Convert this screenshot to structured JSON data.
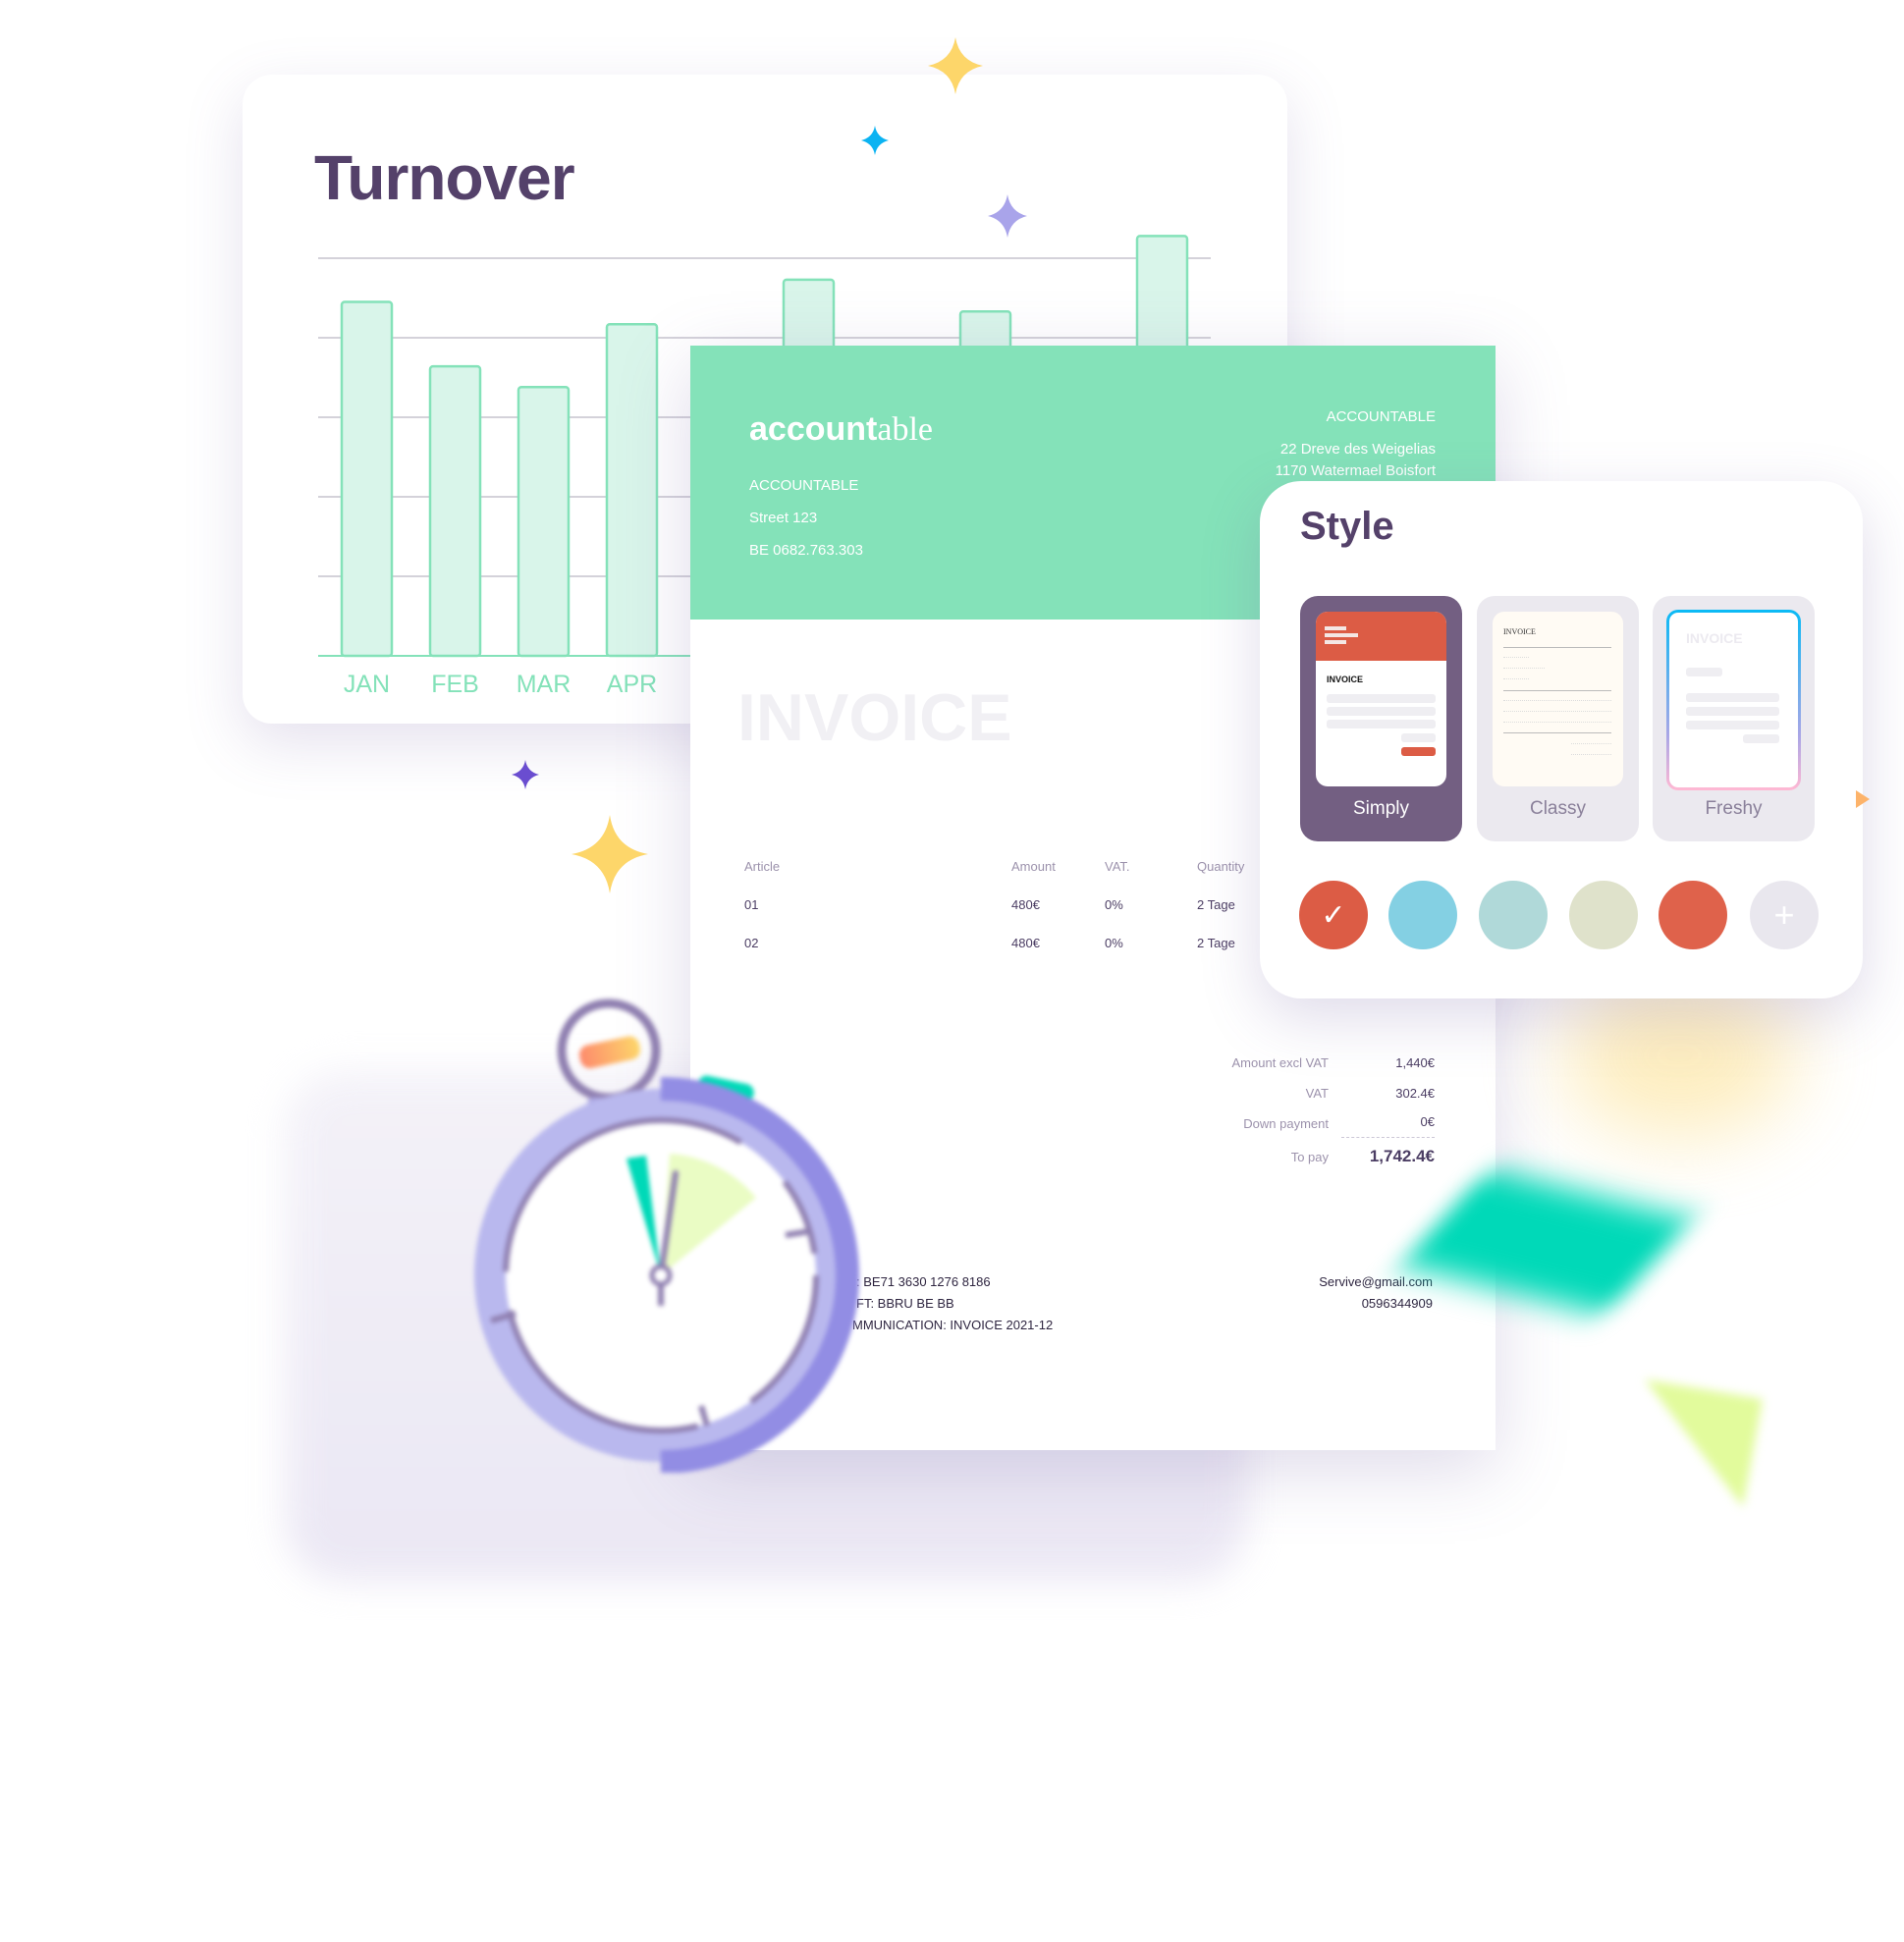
{
  "turnover": {
    "title": "Turnover"
  },
  "chart_data": {
    "type": "bar",
    "title": "Turnover",
    "categories": [
      "JAN",
      "FEB",
      "MAR",
      "APR",
      null,
      null,
      null,
      null,
      null,
      null
    ],
    "values": [
      4.45,
      3.64,
      3.38,
      4.17,
      null,
      4.73,
      null,
      4.33,
      null,
      5.28
    ],
    "xlabel": "",
    "ylabel": "",
    "ylim": [
      0,
      5
    ],
    "grid": true,
    "colors": {
      "fill": "#d9f5ea",
      "stroke": "#84e2b9",
      "grid": "#d4d2da",
      "label": "#84e2b9"
    }
  },
  "invoice": {
    "logo": {
      "bold": "account",
      "light": "able"
    },
    "sender": {
      "name": "ACCOUNTABLE",
      "street": "Street 123",
      "vat": "BE 0682.763.303"
    },
    "recipient": {
      "name": "ACCOUNTABLE",
      "line1": "22 Dreve des Weigelias",
      "line2": "1170 Watermael Boisfort"
    },
    "title": "INVOICE",
    "table": {
      "headers": [
        "Article",
        "Amount",
        "VAT.",
        "Quantity"
      ],
      "rows": [
        [
          "01",
          "480€",
          "0%",
          "2 Tage"
        ],
        [
          "02",
          "480€",
          "0%",
          "2 Tage"
        ]
      ]
    },
    "totals": [
      {
        "label": "Amount excl VAT",
        "value": "1,440€"
      },
      {
        "label": "VAT",
        "value": "302.4€"
      },
      {
        "label": "Down payment",
        "value": "0€"
      },
      {
        "label": "To pay",
        "value": "1,742.4€"
      }
    ],
    "footer": {
      "left": [
        ": BE71 3630 1276 8186",
        "FT: BBRU BE BB",
        "MMUNICATION: INVOICE 2021-12"
      ],
      "email": "Servive@gmail.com",
      "phone": "0596344909"
    },
    "header_color": "#84e2b9"
  },
  "style_panel": {
    "title": "Style",
    "options": [
      {
        "label": "Simply",
        "selected": true,
        "preview_title": "INVOICE"
      },
      {
        "label": "Classy",
        "selected": false,
        "preview_title": "INVOICE"
      },
      {
        "label": "Freshy",
        "selected": false,
        "preview_title": "INVOICE"
      }
    ],
    "swatches": [
      {
        "color": "#dc5c45",
        "selected": true,
        "icon": "check-icon"
      },
      {
        "color": "#84d0e3",
        "selected": false
      },
      {
        "color": "#b0d9d9",
        "selected": false
      },
      {
        "color": "#dfe2cb",
        "selected": false
      },
      {
        "color": "#df624b",
        "selected": false
      },
      {
        "color": "#e9e7ee",
        "selected": false,
        "icon": "plus-icon"
      }
    ],
    "check_glyph": "✓",
    "plus_glyph": "+",
    "accent": "#735f82"
  }
}
